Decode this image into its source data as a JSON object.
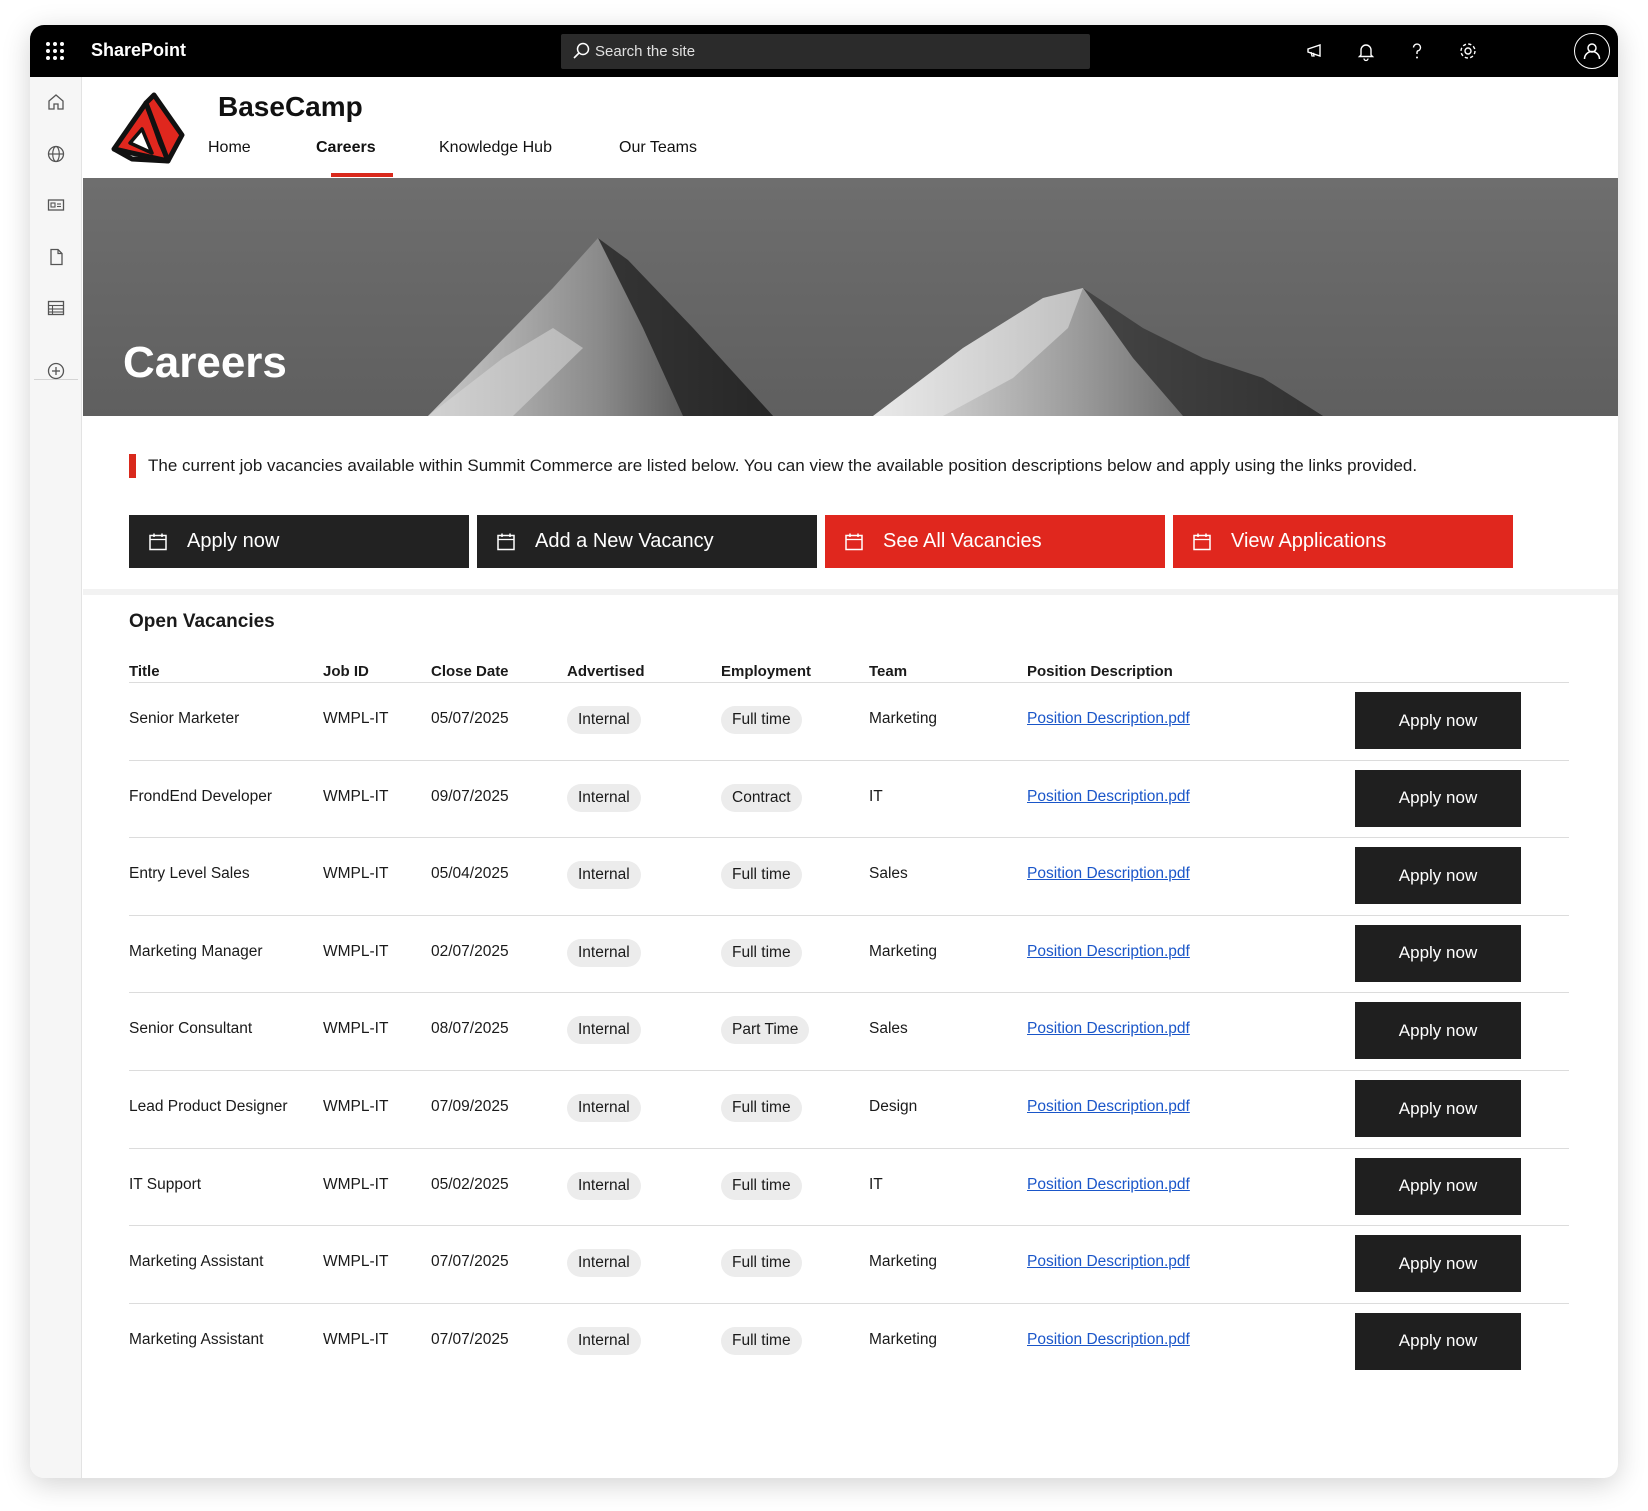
{
  "topbar": {
    "brand": "SharePoint",
    "search_placeholder": "Search the site"
  },
  "site": {
    "title": "BaseCamp",
    "nav": [
      {
        "label": "Home",
        "active": false
      },
      {
        "label": "Careers",
        "active": true
      },
      {
        "label": "Knowledge Hub",
        "active": false
      },
      {
        "label": "Our Teams",
        "active": false
      }
    ]
  },
  "hero": {
    "title": "Careers"
  },
  "intro": {
    "text": "The current job vacancies available within Summit Commerce are listed below. You can view the available position descriptions below and apply using the links provided."
  },
  "actions": [
    {
      "label": "Apply now",
      "style": "dark"
    },
    {
      "label": "Add a New Vacancy",
      "style": "dark"
    },
    {
      "label": "See All Vacancies",
      "style": "red"
    },
    {
      "label": "View Applications",
      "style": "red"
    }
  ],
  "vacancies": {
    "title": "Open Vacancies",
    "columns": [
      "Title",
      "Job ID",
      "Close Date",
      "Advertised",
      "Employment",
      "Team",
      "Position Description"
    ],
    "apply_label": "Apply now",
    "rows": [
      {
        "title": "Senior Marketer",
        "job_id": "WMPL-IT",
        "close_date": "05/07/2025",
        "advertised": "Internal",
        "employment": "Full time",
        "team": "Marketing",
        "description": "Position Description.pdf"
      },
      {
        "title": "FrondEnd Developer",
        "job_id": "WMPL-IT",
        "close_date": "09/07/2025",
        "advertised": "Internal",
        "employment": "Contract",
        "team": "IT",
        "description": "Position Description.pdf"
      },
      {
        "title": "Entry Level Sales",
        "job_id": "WMPL-IT",
        "close_date": "05/04/2025",
        "advertised": "Internal",
        "employment": "Full time",
        "team": "Sales",
        "description": "Position Description.pdf"
      },
      {
        "title": "Marketing Manager",
        "job_id": "WMPL-IT",
        "close_date": "02/07/2025",
        "advertised": "Internal",
        "employment": "Full time",
        "team": "Marketing",
        "description": "Position Description.pdf"
      },
      {
        "title": "Senior Consultant",
        "job_id": "WMPL-IT",
        "close_date": "08/07/2025",
        "advertised": "Internal",
        "employment": "Part Time",
        "team": "Sales",
        "description": "Position Description.pdf"
      },
      {
        "title": "Lead Product Designer",
        "job_id": "WMPL-IT",
        "close_date": "07/09/2025",
        "advertised": "Internal",
        "employment": "Full time",
        "team": "Design",
        "description": "Position Description.pdf"
      },
      {
        "title": "IT Support",
        "job_id": "WMPL-IT",
        "close_date": "05/02/2025",
        "advertised": "Internal",
        "employment": "Full time",
        "team": "IT",
        "description": "Position Description.pdf"
      },
      {
        "title": "Marketing Assistant",
        "job_id": "WMPL-IT",
        "close_date": "07/07/2025",
        "advertised": "Internal",
        "employment": "Full time",
        "team": "Marketing",
        "description": "Position Description.pdf"
      },
      {
        "title": "Marketing Assistant",
        "job_id": "WMPL-IT",
        "close_date": "07/07/2025",
        "advertised": "Internal",
        "employment": "Full time",
        "team": "Marketing",
        "description": "Position Description.pdf"
      }
    ]
  },
  "colors": {
    "accent": "#e0271e",
    "dark": "#222222",
    "link": "#1a56c9"
  },
  "icons": [
    "waffle-icon",
    "search-icon",
    "megaphone-icon",
    "bell-icon",
    "help-icon",
    "gear-icon",
    "avatar-icon",
    "home-icon",
    "globe-icon",
    "news-icon",
    "file-icon",
    "list-icon",
    "add-icon",
    "calendar-icon"
  ]
}
